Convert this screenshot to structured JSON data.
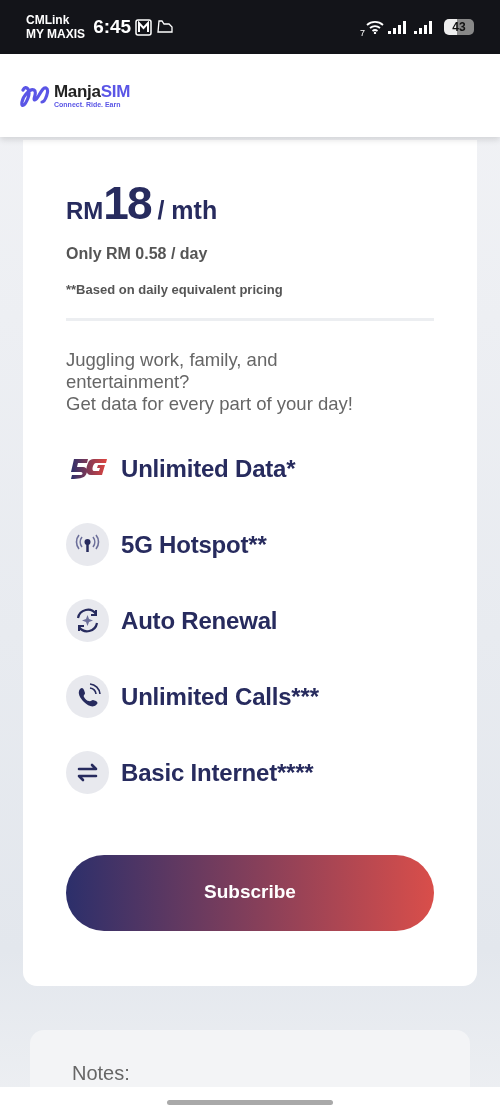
{
  "status_bar": {
    "carrier_1": "CMLink",
    "carrier_2": "MY MAXIS",
    "time": "6:45",
    "wifi_label": "7",
    "battery": "43"
  },
  "header": {
    "brand_1": "Manja",
    "brand_2": "SIM",
    "tagline": "Connect. Ride. Earn"
  },
  "plan": {
    "currency": "RM",
    "amount": "18",
    "period": "/ mth",
    "daily": "Only RM 0.58 / day",
    "footnote": "**Based on daily equivalent pricing",
    "description": [
      "Juggling work, family, and entertainment?",
      "Get data for every part of your day!"
    ],
    "features": [
      {
        "kind": "badge5g",
        "label": "Unlimited Data*"
      },
      {
        "kind": "hotspot",
        "label": "5G Hotspot**"
      },
      {
        "kind": "renewal",
        "label": "Auto Renewal"
      },
      {
        "kind": "calls",
        "label": "Unlimited Calls***"
      },
      {
        "kind": "internet",
        "label": "Basic Internet****"
      }
    ],
    "button": "Subscribe"
  },
  "notes": {
    "title": "Notes:"
  }
}
